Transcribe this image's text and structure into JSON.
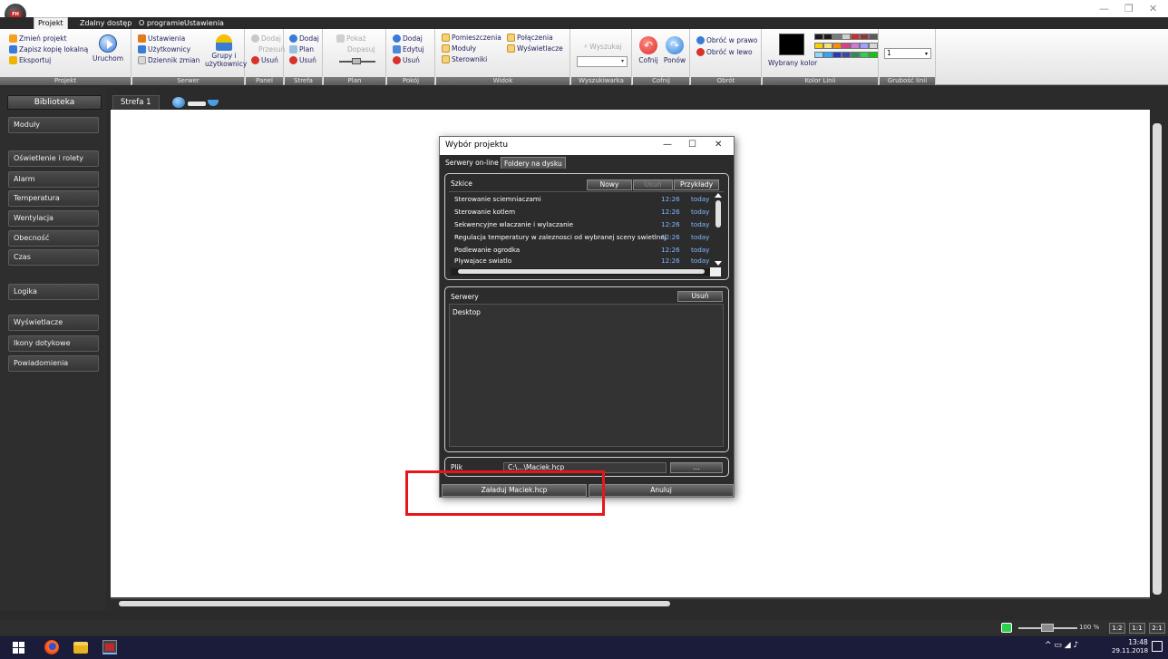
{
  "window": {
    "menu_tabs": [
      "Projekt",
      "Zdalny dostęp",
      "O programie",
      "Ustawienia"
    ],
    "controls": [
      "—",
      "❐",
      "✕"
    ]
  },
  "ribbon": {
    "projekt": {
      "items": [
        "Zmień projekt",
        "Zapisz kopię lokalną",
        "Eksportuj"
      ],
      "run": "Uruchom",
      "label": "Projekt"
    },
    "serwer": {
      "items": [
        "Ustawienia",
        "Użytkownicy",
        "Dziennik zmian"
      ],
      "groups_line1": "Grupy i",
      "groups_line2": "użytkownicy",
      "label": "Serwer"
    },
    "panel": {
      "items": [
        "Dodaj",
        "Przesuń",
        "Usuń"
      ],
      "label": "Panel"
    },
    "strefa": {
      "items": [
        "Dodaj",
        "Plan",
        "Usuń"
      ],
      "label": "Strefa"
    },
    "plan": {
      "items": [
        "Pokaż",
        "Dopasuj"
      ],
      "label": "Plan"
    },
    "pokoj": {
      "items": [
        "Dodaj",
        "Edytuj",
        "Usuń"
      ],
      "label": "Pokój"
    },
    "widok": {
      "col1": [
        "Pomieszczenia",
        "Moduły",
        "Sterowniki"
      ],
      "col2": [
        "Połączenia",
        "Wyświetlacze"
      ],
      "label": "Widok"
    },
    "wyszukiwarka": {
      "button": "Wyszukaj",
      "label": "Wyszukiwarka"
    },
    "cofnij": {
      "undo": "Cofnij",
      "redo": "Ponów",
      "label": "Cofnij"
    },
    "obrot": {
      "items": [
        "Obróć w prawo",
        "Obróć w lewo"
      ],
      "label": "Obrót"
    },
    "kolor": {
      "selected": "Wybrany kolor",
      "label": "Kolor Linii"
    },
    "grubosc": {
      "value": "1",
      "label": "Grubość linii"
    }
  },
  "colors": {
    "accent": "#3a7bd5",
    "undo": "#d9312b",
    "palette_row1": [
      "#1a1a1a",
      "#1a1a1a",
      "#7a7a7a",
      "#cfcfcf",
      "#c83030",
      "#8b3a3a",
      "#5a5a5a"
    ],
    "palette_row2": [
      "#f5d000",
      "#f7e07a",
      "#ff8a00",
      "#e03c8a",
      "#d07ad8",
      "#a0a0ff",
      "#d8d8d8"
    ],
    "palette_row3": [
      "#8fd8ff",
      "#2aa8ff",
      "#1e3cbf",
      "#3a4aa8",
      "#2e8b57",
      "#2bd04c",
      "#00d000"
    ]
  },
  "sidebar": {
    "header": "Biblioteka",
    "items": [
      "Moduły",
      "Oświetlenie i rolety",
      "Alarm",
      "Temperatura",
      "Wentylacja",
      "Obecność",
      "Czas",
      "Logika",
      "Wyświetlacze",
      "Ikony dotykowe",
      "Powiadomienia"
    ]
  },
  "zone_tab": "Strefa 1",
  "dialog": {
    "title": "Wybór projektu",
    "tabs": [
      "Serwery on-line",
      "Foldery na dysku"
    ],
    "sketches": {
      "header": "Szkice",
      "buttons": [
        "Nowy",
        "Usuń",
        "Przykłady"
      ],
      "rows": [
        {
          "name": "Sterowanie sciemniaczami",
          "time": "12:26",
          "day": "today"
        },
        {
          "name": "Sterowanie kotlem",
          "time": "12:26",
          "day": "today"
        },
        {
          "name": "Sekwencyjne wlaczanie i wylaczanie",
          "time": "12:26",
          "day": "today"
        },
        {
          "name": "Regulacja temperatury w zaleznosci od wybranej sceny swietlnej",
          "time": "12:26",
          "day": "today"
        },
        {
          "name": "Podlewanie ogrodka",
          "time": "12:26",
          "day": "today"
        },
        {
          "name": "Plywajace swiatlo",
          "time": "12:26",
          "day": "today"
        }
      ]
    },
    "servers": {
      "header": "Serwery",
      "button": "Usuń",
      "items": [
        "Desktop"
      ]
    },
    "file": {
      "label": "Plik",
      "value": "C:\\...\\Maciek.hcp",
      "browse": "..."
    },
    "load_button": "Załaduj  Maciek.hcp",
    "cancel_button": "Anuluj"
  },
  "statusbar": {
    "zoom": "100 %",
    "ratios": [
      "1:2",
      "1:1",
      "2:1"
    ]
  },
  "taskbar": {
    "time": "13:48",
    "date": "29.11.2018"
  }
}
